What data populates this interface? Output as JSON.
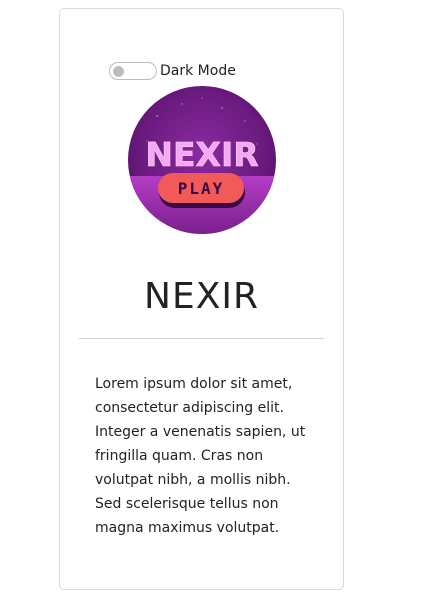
{
  "toggle": {
    "label": "Dark Mode",
    "checked": false
  },
  "logo": {
    "text": "NEXIR",
    "button_text": "PLAY",
    "icon": "nexir-play-logo"
  },
  "card": {
    "title": "NEXIR",
    "description": "Lorem ipsum dolor sit amet, consectetur adipiscing elit. Integer a venenatis sapien, ut fringilla quam. Cras non volutpat nibh, a mollis nibh. Sed scelerisque tellus non magna maximus volutpat."
  },
  "colors": {
    "logo_bg": "#7a1f8e",
    "logo_glow": "#f6a8f5",
    "play_button": "#f25a5a",
    "text": "#222222",
    "border": "#d9d9d9"
  }
}
